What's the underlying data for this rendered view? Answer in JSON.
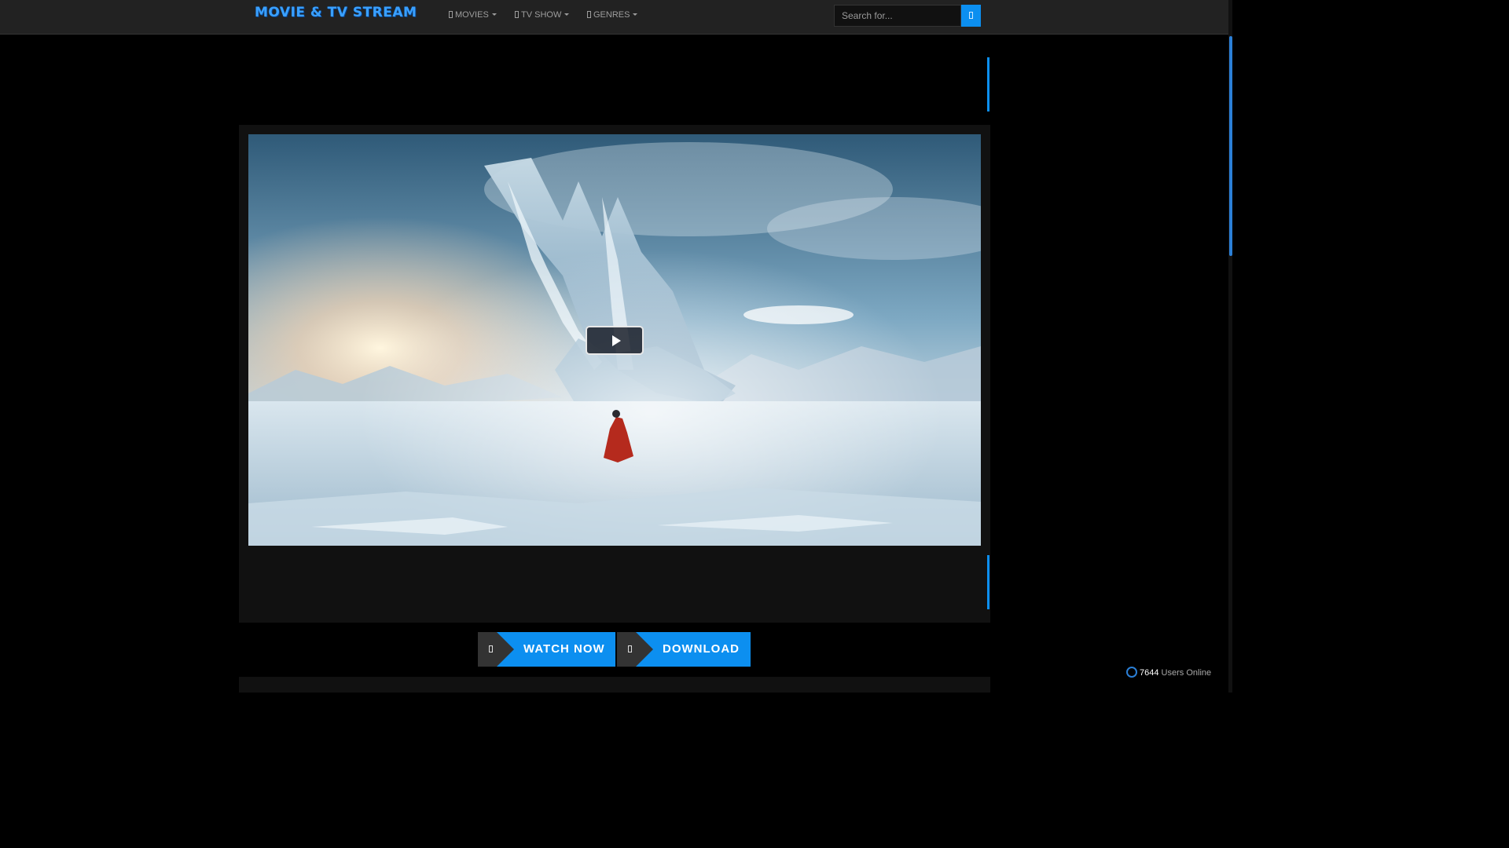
{
  "brand": {
    "title": "MOVIE & TV STREAM"
  },
  "nav": {
    "items": [
      {
        "label": "MOVIES",
        "icon": "film-icon"
      },
      {
        "label": "TV SHOW",
        "icon": "tv-icon"
      },
      {
        "label": "GENRES",
        "icon": "tags-icon"
      }
    ]
  },
  "search": {
    "placeholder": "Search for...",
    "icon": "search-icon"
  },
  "player": {
    "play_icon": "play-icon"
  },
  "actions": {
    "watch": {
      "label": "WATCH NOW",
      "icon": "play-circle-icon"
    },
    "download": {
      "label": "DOWNLOAD",
      "icon": "download-icon"
    }
  },
  "online": {
    "count": "7644",
    "suffix": "Users Online",
    "icon": "users-icon"
  },
  "colors": {
    "accent": "#0c8ff0",
    "navbar": "#222222",
    "panel": "#111111",
    "background": "#000000"
  }
}
